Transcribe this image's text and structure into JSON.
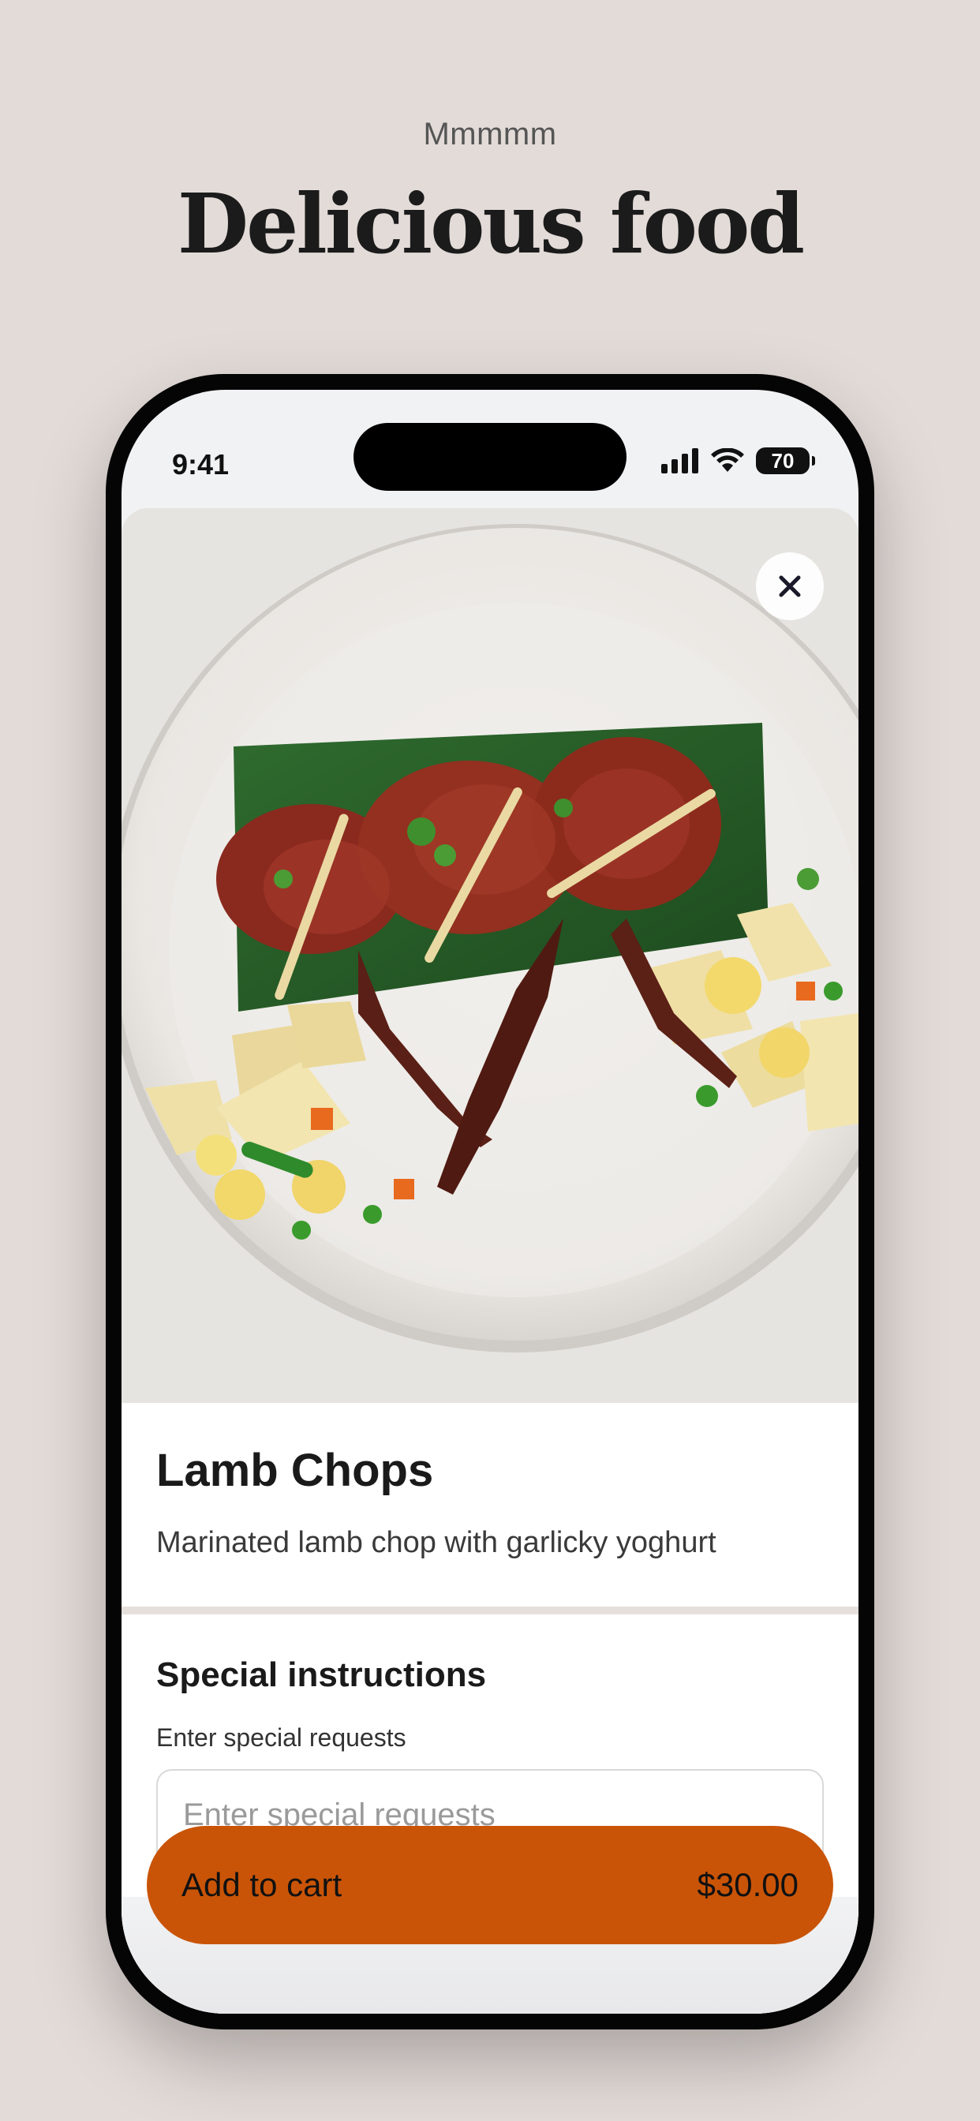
{
  "header": {
    "eyebrow": "Mmmmm",
    "title": "Delicious food"
  },
  "status_bar": {
    "time": "9:41",
    "battery": "70"
  },
  "item": {
    "image_icon": "lamb-chops-photo",
    "name": "Lamb Chops",
    "description": "Marinated lamb chop with garlicky yoghurt"
  },
  "instructions": {
    "title": "Special instructions",
    "label": "Enter special requests",
    "placeholder": "Enter special requests"
  },
  "cart": {
    "label": "Add to cart",
    "price": "$30.00"
  },
  "colors": {
    "background": "#e3dbd8",
    "accent": "#c95407"
  }
}
